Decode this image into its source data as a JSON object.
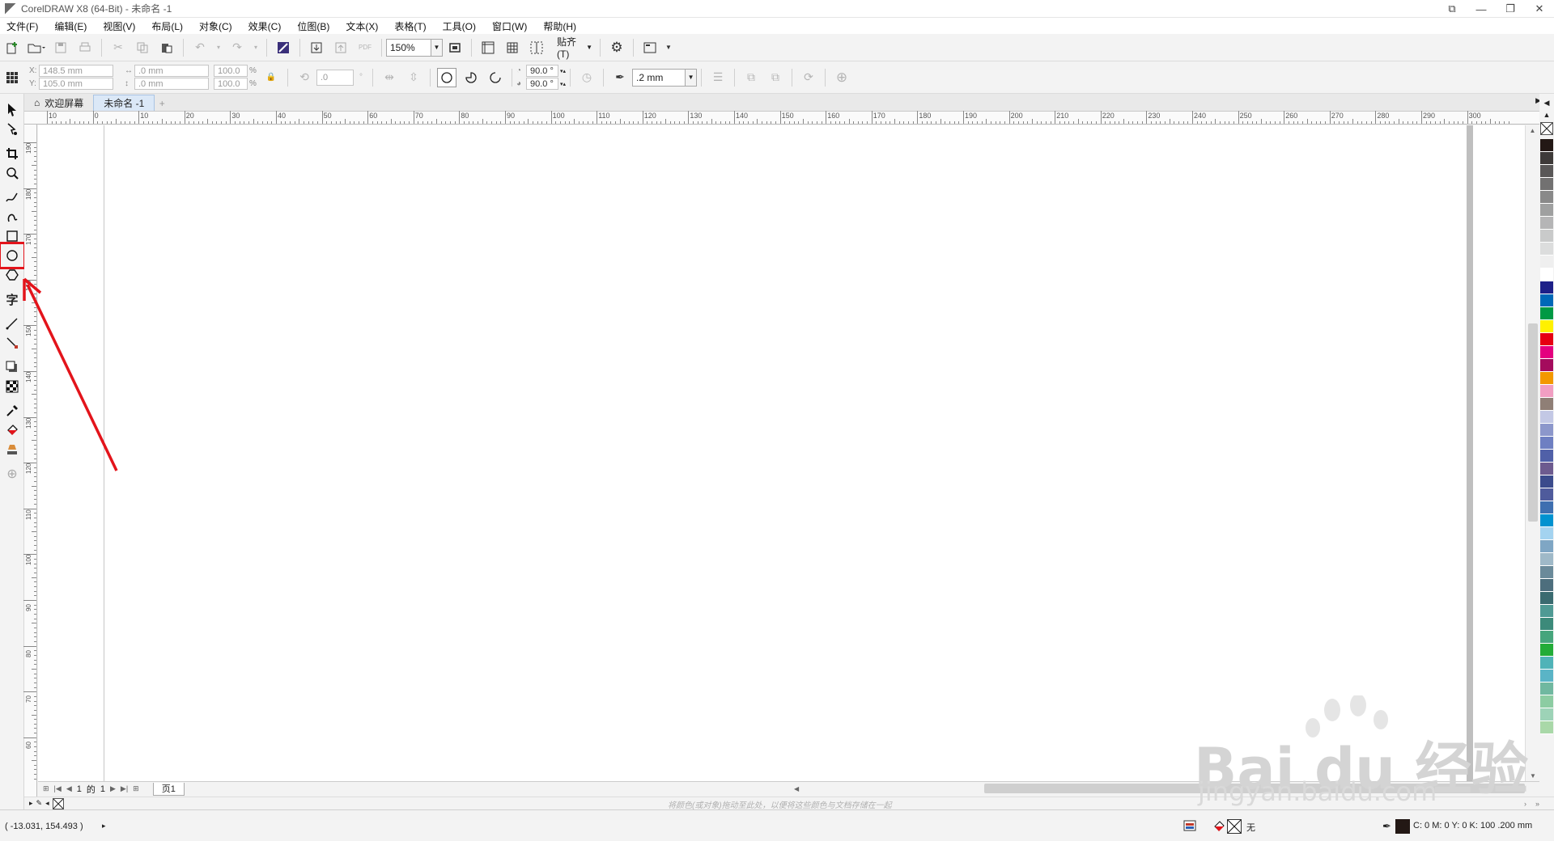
{
  "window": {
    "title": "CorelDRAW X8 (64-Bit) - 未命名 -1"
  },
  "menu": [
    "文件(F)",
    "编辑(E)",
    "视图(V)",
    "布局(L)",
    "对象(C)",
    "效果(C)",
    "位图(B)",
    "文本(X)",
    "表格(T)",
    "工具(O)",
    "窗口(W)",
    "帮助(H)"
  ],
  "standard_toolbar": {
    "zoom": "150%",
    "snap_label": "贴齐(T)"
  },
  "property_bar": {
    "x": "148.5 mm",
    "y": "105.0 mm",
    "w": ".0 mm",
    "h": ".0 mm",
    "scale_x": "100.0",
    "scale_y": "100.0",
    "percent": "%",
    "rotation": ".0",
    "start_angle": "90.0 °",
    "end_angle": "90.0 °",
    "outline_width": ".2 mm",
    "pdf_label": "PDF"
  },
  "tabs": [
    {
      "label": "欢迎屏幕"
    },
    {
      "label": "未命名 -1"
    }
  ],
  "ruler_h": [
    "10",
    "0",
    "10",
    "20",
    "30",
    "40",
    "50",
    "60",
    "70",
    "80",
    "90",
    "100",
    "110",
    "120",
    "130",
    "140",
    "150",
    "160",
    "170",
    "180",
    "190",
    "200",
    "210",
    "220",
    "230",
    "240",
    "250",
    "260",
    "270",
    "280",
    "290",
    "300"
  ],
  "ruler_v": [
    "190",
    "180",
    "170",
    "160",
    "150",
    "140",
    "130",
    "120",
    "110",
    "100",
    "90",
    "80",
    "70",
    "60"
  ],
  "page_nav": {
    "current": "1",
    "of": "的",
    "total": "1",
    "page_tab": "页1"
  },
  "color_hint": "将颜色(或对象)拖动至此处，以便将这些颜色与文档存储在一起",
  "status": {
    "coords": "( -13.031, 154.493 )",
    "fill": "无",
    "outline": "C: 0 M: 0 Y: 0 K: 100  .200 mm"
  },
  "palette": [
    "#231815",
    "#3e3a39",
    "#595757",
    "#727171",
    "#898989",
    "#9fa0a0",
    "#b5b5b6",
    "#c9caca",
    "#dcdddd",
    "#efefef",
    "#ffffff",
    "#1d2088",
    "#0068b7",
    "#009944",
    "#fff100",
    "#e60012",
    "#e4007f",
    "#a40b5d",
    "#f39800",
    "#f19ec2",
    "#8f7f76",
    "#c3c8e5",
    "#8c97cb",
    "#6e7fc2",
    "#5060a8",
    "#6d5b8f",
    "#3b4b8c",
    "#4f5b9c",
    "#3e6fb0",
    "#0092d0",
    "#a3d3f0",
    "#7fa6c4",
    "#9fb9c8",
    "#6a8a9a",
    "#4d6e7d",
    "#3a6b70",
    "#4f9a94",
    "#3c8a7a",
    "#46a57c",
    "#22ac38",
    "#4fb3b8",
    "#5ab4c6",
    "#70b8a0",
    "#8ccca2",
    "#9dd3b7",
    "#a9d8a8"
  ],
  "watermark": {
    "main": "Bai du 经验",
    "sub": "jingyan.baidu.com"
  }
}
